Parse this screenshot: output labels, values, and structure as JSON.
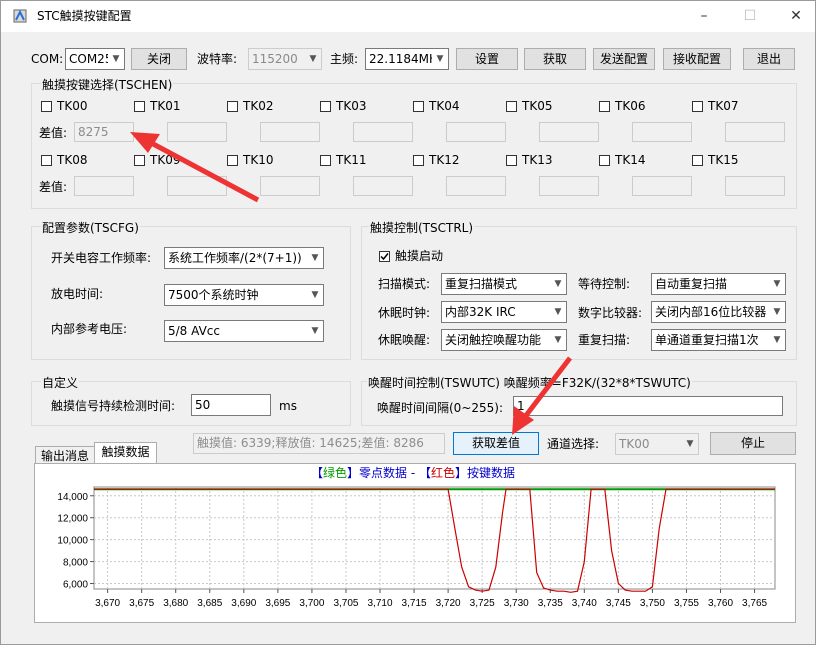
{
  "window": {
    "title": "STC触摸按键配置",
    "minimize": "–",
    "maximize": "☐",
    "close": "✕"
  },
  "top": {
    "com_label": "COM:",
    "com_value": "COM25",
    "close_button": "关闭",
    "baud_label": "波特率:",
    "baud_value": "115200",
    "freq_label": "主频:",
    "freq_value": "22.1184MH",
    "set_button": "设置",
    "get_button": "获取",
    "send_button": "发送配置",
    "recv_button": "接收配置",
    "exit_button": "退出"
  },
  "tschen": {
    "title": "触摸按键选择(TSCHEN)",
    "diff_label": "差值:",
    "keys_row1": [
      "TK00",
      "TK01",
      "TK02",
      "TK03",
      "TK04",
      "TK05",
      "TK06",
      "TK07"
    ],
    "keys_row2": [
      "TK08",
      "TK09",
      "TK10",
      "TK11",
      "TK12",
      "TK13",
      "TK14",
      "TK15"
    ],
    "first_value": "8275"
  },
  "tscfg": {
    "title": "配置参数(TSCFG)",
    "switch_freq_label": "开关电容工作频率:",
    "switch_freq_value": "系统工作频率/(2*(7+1))",
    "discharge_label": "放电时间:",
    "discharge_value": "7500个系统时钟",
    "vref_label": "内部参考电压:",
    "vref_value": "5/8 AVcc"
  },
  "tsctrl": {
    "title": "触摸控制(TSCTRL)",
    "enable_label": "触摸启动",
    "scan_mode_label": "扫描模式:",
    "scan_mode_value": "重复扫描模式",
    "wait_label": "等待控制:",
    "wait_value": "自动重复扫描",
    "sleep_clk_label": "休眠时钟:",
    "sleep_clk_value": "内部32K IRC",
    "comparator_label": "数字比较器:",
    "comparator_value": "关闭内部16位比较器",
    "wake_label": "休眠唤醒:",
    "wake_value": "关闭触控唤醒功能",
    "repeat_label": "重复扫描:",
    "repeat_value": "单通道重复扫描1次"
  },
  "custom": {
    "title": "自定义",
    "detect_label": "触摸信号持续检测时间:",
    "detect_value": "50",
    "unit": "ms"
  },
  "wutc": {
    "title": "唤醒时间控制(TSWUTC) 唤醒频率=F32K/(32*8*TSWUTC)",
    "interval_label": "唤醒时间间隔(0~255):",
    "interval_value": "1"
  },
  "bottom": {
    "tab_output": "输出消息",
    "tab_touch": "触摸数据",
    "status_text": "触摸值: 6339;释放值: 14625;差值: 8286",
    "get_diff_button": "获取差值",
    "channel_label": "通道选择:",
    "channel_value": "TK00",
    "stop_button": "停止"
  },
  "chart_data": {
    "type": "line",
    "title": "【绿色】零点数据 - 【红色】按键数据",
    "title_parts": {
      "p1": "【",
      "p2": "绿色",
      "p3": "】零点数据 - 【",
      "p4": "红色",
      "p5": "】按键数据"
    },
    "xlim": [
      3668,
      3768
    ],
    "ylim": [
      5500,
      14800
    ],
    "x_ticks": [
      3670,
      3675,
      3680,
      3685,
      3690,
      3695,
      3700,
      3705,
      3710,
      3715,
      3720,
      3725,
      3730,
      3735,
      3740,
      3745,
      3750,
      3755,
      3760,
      3765
    ],
    "x_tick_labels": [
      "3,670",
      "3,675",
      "3,680",
      "3,685",
      "3,690",
      "3,695",
      "3,700",
      "3,705",
      "3,710",
      "3,715",
      "3,720",
      "3,725",
      "3,730",
      "3,735",
      "3,740",
      "3,745",
      "3,750",
      "3,755",
      "3,760",
      "3,765"
    ],
    "y_ticks": [
      6000,
      8000,
      10000,
      12000,
      14000
    ],
    "y_tick_labels": [
      "6,000",
      "8,000",
      "10,000",
      "12,000",
      "14,000"
    ],
    "grid": true,
    "series": [
      {
        "name": "零点数据",
        "color": "#009900",
        "x": [
          3668,
          3768
        ],
        "y": [
          14600,
          14600
        ]
      },
      {
        "name": "按键数据",
        "color": "#cc0000",
        "x": [
          3668,
          3720,
          3721,
          3722,
          3723,
          3724,
          3725,
          3726,
          3727,
          3728,
          3728.5,
          3729,
          3730,
          3731,
          3732,
          3733,
          3734,
          3735,
          3736,
          3737,
          3738,
          3739,
          3740,
          3741,
          3742,
          3743,
          3744,
          3745,
          3746,
          3747,
          3748,
          3749,
          3750,
          3751,
          3752,
          3753,
          3768
        ],
        "y": [
          14600,
          14600,
          11000,
          7500,
          5700,
          5400,
          5300,
          5400,
          7500,
          12500,
          14600,
          14600,
          14600,
          14600,
          14600,
          7000,
          5600,
          5400,
          5300,
          5300,
          5200,
          5300,
          8000,
          14600,
          14600,
          14600,
          9000,
          6000,
          5400,
          5300,
          5300,
          5300,
          5700,
          11000,
          14600,
          14600,
          14600
        ]
      }
    ]
  },
  "colors": {
    "green": "#009900",
    "red": "#cc0000",
    "title_blue": "#0000cc",
    "arrow": "#ee3333"
  }
}
